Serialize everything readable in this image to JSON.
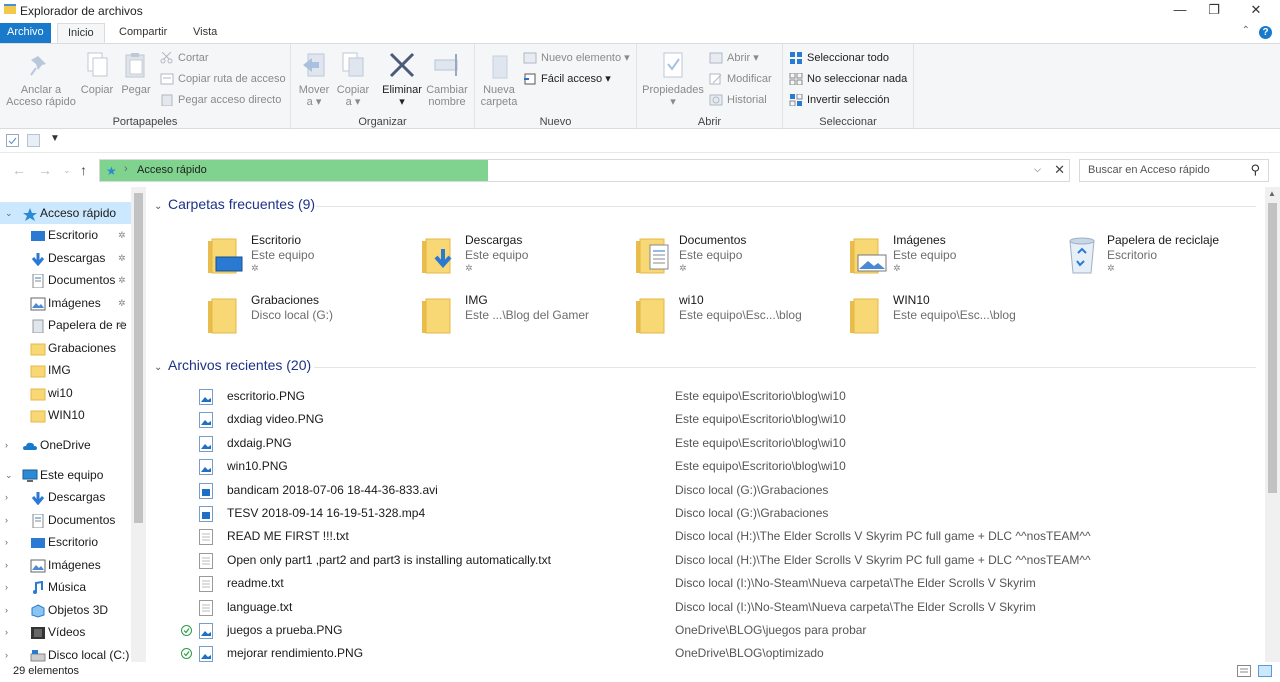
{
  "window": {
    "title": "Explorador de archivos"
  },
  "ribbon_tabs": [
    {
      "label": "Archivo"
    },
    {
      "label": "Inicio"
    },
    {
      "label": "Compartir"
    },
    {
      "label": "Vista"
    }
  ],
  "ribbon": {
    "portapapeles": {
      "label": "Portapapeles",
      "pin_label": "Anclar a\nAcceso rápido",
      "copy_label": "Copiar",
      "paste_label": "Pegar",
      "cut_label": "Cortar",
      "copy_path_label": "Copiar ruta de acceso",
      "paste_shortcut_label": "Pegar acceso directo"
    },
    "organizar": {
      "label": "Organizar",
      "move_label": "Mover\na ▾",
      "copyto_label": "Copiar\na ▾",
      "delete_label": "Eliminar\n▾",
      "rename_label": "Cambiar\nnombre"
    },
    "nuevo": {
      "label": "Nuevo",
      "new_folder_label": "Nueva\ncarpeta",
      "new_item_label": "Nuevo elemento ▾",
      "easy_access_label": "Fácil acceso ▾"
    },
    "abrir": {
      "label": "Abrir",
      "properties_label": "Propiedades\n▾",
      "open_label": "Abrir ▾",
      "edit_label": "Modificar",
      "history_label": "Historial"
    },
    "seleccionar": {
      "label": "Seleccionar",
      "select_all_label": "Seleccionar todo",
      "select_none_label": "No seleccionar nada",
      "invert_label": "Invertir selección"
    }
  },
  "address": {
    "crumb": "Acceso rápido",
    "progress": 0.4,
    "search_placeholder": "Buscar en Acceso rápido"
  },
  "nav": {
    "quick_access": "Acceso rápido",
    "quick_items": [
      {
        "label": "Escritorio",
        "pinned": true
      },
      {
        "label": "Descargas",
        "pinned": true
      },
      {
        "label": "Documentos",
        "pinned": true
      },
      {
        "label": "Imágenes",
        "pinned": true
      },
      {
        "label": "Papelera de re",
        "pinned": true
      },
      {
        "label": "Grabaciones",
        "pinned": false
      },
      {
        "label": "IMG",
        "pinned": false
      },
      {
        "label": "wi10",
        "pinned": false
      },
      {
        "label": "WIN10",
        "pinned": false
      }
    ],
    "onedrive": "OneDrive",
    "this_pc": "Este equipo",
    "pc_items": [
      {
        "label": "Descargas"
      },
      {
        "label": "Documentos"
      },
      {
        "label": "Escritorio"
      },
      {
        "label": "Imágenes"
      },
      {
        "label": "Música"
      },
      {
        "label": "Objetos 3D"
      },
      {
        "label": "Vídeos"
      },
      {
        "label": "Disco local (C:)"
      }
    ]
  },
  "frequent": {
    "header": "Carpetas frecuentes (9)",
    "items": [
      {
        "name": "Escritorio",
        "sub": "Este equipo",
        "pinned": true
      },
      {
        "name": "Descargas",
        "sub": "Este equipo",
        "pinned": true
      },
      {
        "name": "Documentos",
        "sub": "Este equipo",
        "pinned": true
      },
      {
        "name": "Imágenes",
        "sub": "Este equipo",
        "pinned": true
      },
      {
        "name": "Papelera de reciclaje",
        "sub": "Escritorio",
        "pinned": true
      },
      {
        "name": "Grabaciones",
        "sub": "Disco local (G:)",
        "pinned": false
      },
      {
        "name": "IMG",
        "sub": "Este ...\\Blog del Gamer",
        "pinned": false
      },
      {
        "name": "wi10",
        "sub": "Este equipo\\Esc...\\blog",
        "pinned": false
      },
      {
        "name": "WIN10",
        "sub": "Este equipo\\Esc...\\blog",
        "pinned": false
      }
    ]
  },
  "recent": {
    "header": "Archivos recientes (20)",
    "items": [
      {
        "name": "escritorio.PNG",
        "path": "Este equipo\\Escritorio\\blog\\wi10",
        "type": "image",
        "synced": false
      },
      {
        "name": "dxdiag video.PNG",
        "path": "Este equipo\\Escritorio\\blog\\wi10",
        "type": "image",
        "synced": false
      },
      {
        "name": "dxdaig.PNG",
        "path": "Este equipo\\Escritorio\\blog\\wi10",
        "type": "image",
        "synced": false
      },
      {
        "name": "win10.PNG",
        "path": "Este equipo\\Escritorio\\blog\\wi10",
        "type": "image",
        "synced": false
      },
      {
        "name": "bandicam 2018-07-06 18-44-36-833.avi",
        "path": "Disco local (G:)\\Grabaciones",
        "type": "video",
        "synced": false
      },
      {
        "name": "TESV 2018-09-14 16-19-51-328.mp4",
        "path": "Disco local (G:)\\Grabaciones",
        "type": "video",
        "synced": false
      },
      {
        "name": "READ ME FIRST !!!.txt",
        "path": "Disco local (H:)\\The Elder Scrolls V Skyrim PC full game + DLC ^^nosTEAM^^",
        "type": "text",
        "synced": false
      },
      {
        "name": "Open only part1   ,part2 and part3  is installing automatically.txt",
        "path": "Disco local (H:)\\The Elder Scrolls V Skyrim PC full game + DLC ^^nosTEAM^^",
        "type": "text",
        "synced": false
      },
      {
        "name": "readme.txt",
        "path": "Disco local (I:)\\No-Steam\\Nueva carpeta\\The Elder Scrolls V Skyrim",
        "type": "text",
        "synced": false
      },
      {
        "name": "language.txt",
        "path": "Disco local (I:)\\No-Steam\\Nueva carpeta\\The Elder Scrolls V Skyrim",
        "type": "text",
        "synced": false
      },
      {
        "name": "juegos a prueba.PNG",
        "path": "OneDrive\\BLOG\\juegos para probar",
        "type": "image",
        "synced": true
      },
      {
        "name": "mejorar rendimiento.PNG",
        "path": "OneDrive\\BLOG\\optimizado",
        "type": "image",
        "synced": true
      }
    ]
  },
  "status": {
    "count": "29 elementos"
  },
  "colors": {
    "accent": "#1979ca",
    "progress": "#7fd38e",
    "folder": "#f8d775",
    "header": "#1e3287",
    "selected": "#cce8ff"
  }
}
